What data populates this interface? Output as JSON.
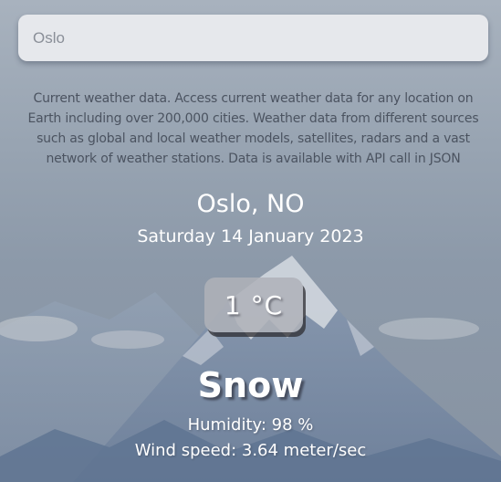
{
  "search": {
    "value": "",
    "placeholder": "Oslo"
  },
  "description": "Current weather data. Access current weather data for any location on Earth including over 200,000 cities. Weather data from different sources such as global and local weather models, satellites, radars and a vast network of weather stations. Data is available with API call in JSON",
  "weather": {
    "location": "Oslo, NO",
    "date": "Saturday 14 January 2023",
    "temperature": "1 °C",
    "condition": "Snow",
    "humidity": "Humidity: 98 %",
    "wind": "Wind speed: 3.64 meter/sec"
  },
  "colors": {
    "sky": "#a8b2be",
    "mountain": "#7d8fa6",
    "snow": "#dcdfe4",
    "text": "#ffffff"
  }
}
